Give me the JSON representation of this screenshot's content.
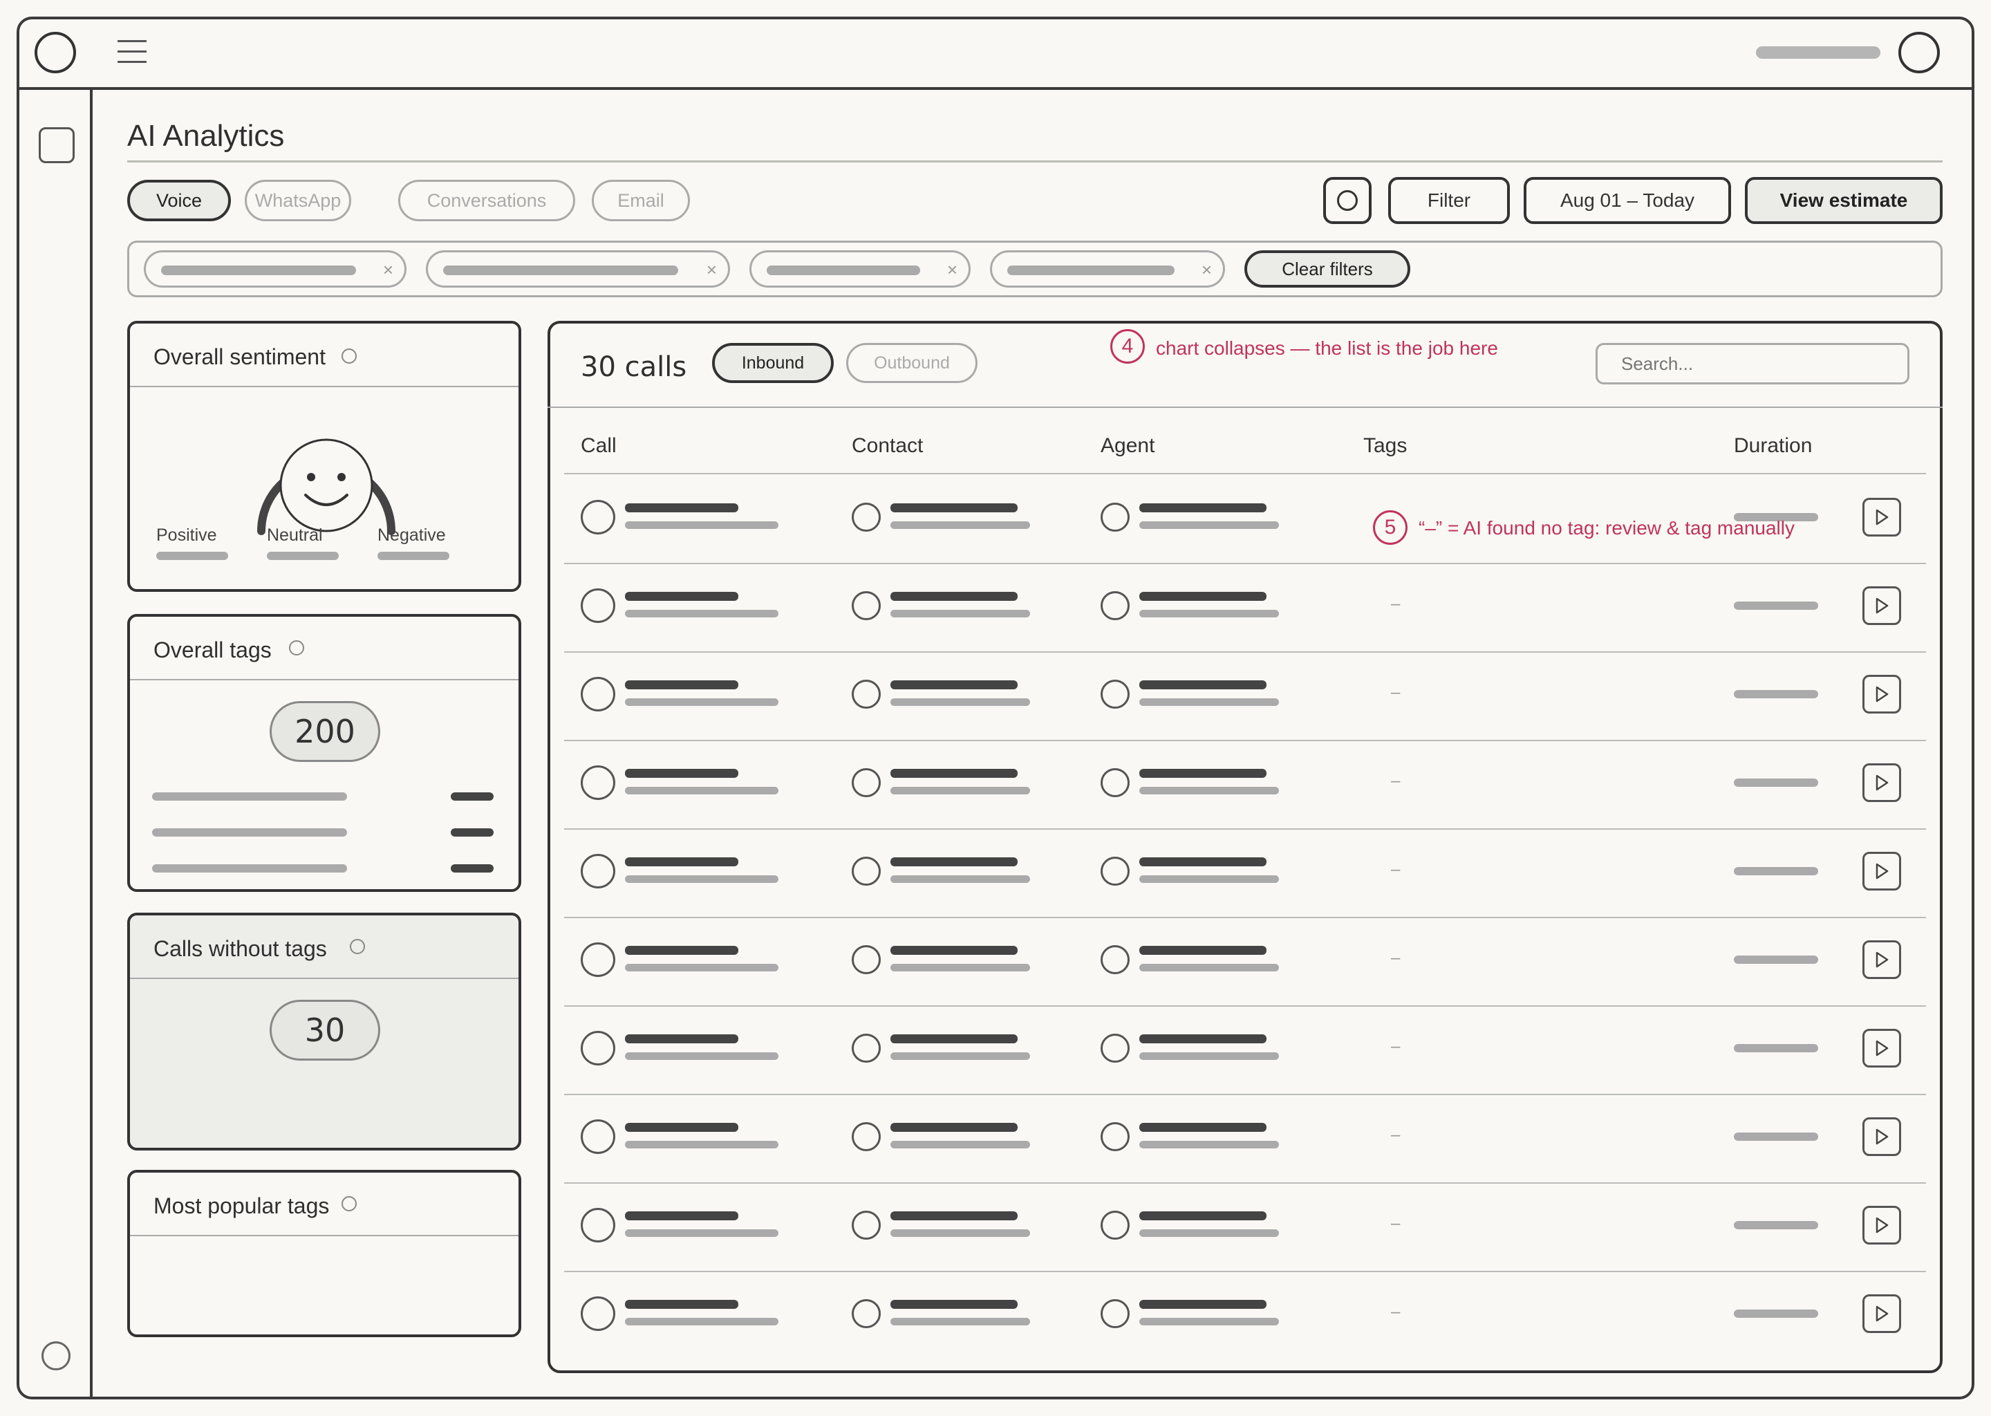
{
  "page": {
    "title": "AI Analytics"
  },
  "channels": [
    {
      "label": "Voice",
      "active": true
    },
    {
      "label": "WhatsApp",
      "active": false
    },
    {
      "label": "Conversations",
      "active": false
    },
    {
      "label": "Email",
      "active": false
    }
  ],
  "toolbar": {
    "filter_label": "Filter",
    "date_range": "Aug 01 – Today",
    "view_estimate_label": "View estimate"
  },
  "filters": {
    "clear_label": "Clear filters",
    "remove_glyph": "×"
  },
  "cards": {
    "sentiment": {
      "title": "Overall sentiment",
      "labels": [
        "Positive",
        "Neutral",
        "Negative"
      ]
    },
    "tags": {
      "title": "Overall tags",
      "count": "200"
    },
    "untagged": {
      "title": "Calls without tags",
      "count": "30"
    },
    "popular": {
      "title": "Most popular tags"
    }
  },
  "calls": {
    "title": "30 calls",
    "direction": [
      "Inbound",
      "Outbound"
    ],
    "search_placeholder": "Search...",
    "columns": [
      "Call",
      "Contact",
      "Agent",
      "Tags",
      "Duration"
    ],
    "no_tag_glyph": "–"
  },
  "annotations": {
    "note4": {
      "number": "4",
      "text": "chart collapses — the list is the job here"
    },
    "note5": {
      "number": "5",
      "text": "“–” = AI found no tag: review & tag manually"
    }
  },
  "colors": {
    "ink": "#333333",
    "annotation": "#c0335e",
    "placeholder": "#aaaaaa",
    "canvas": "#f9f8f4"
  }
}
